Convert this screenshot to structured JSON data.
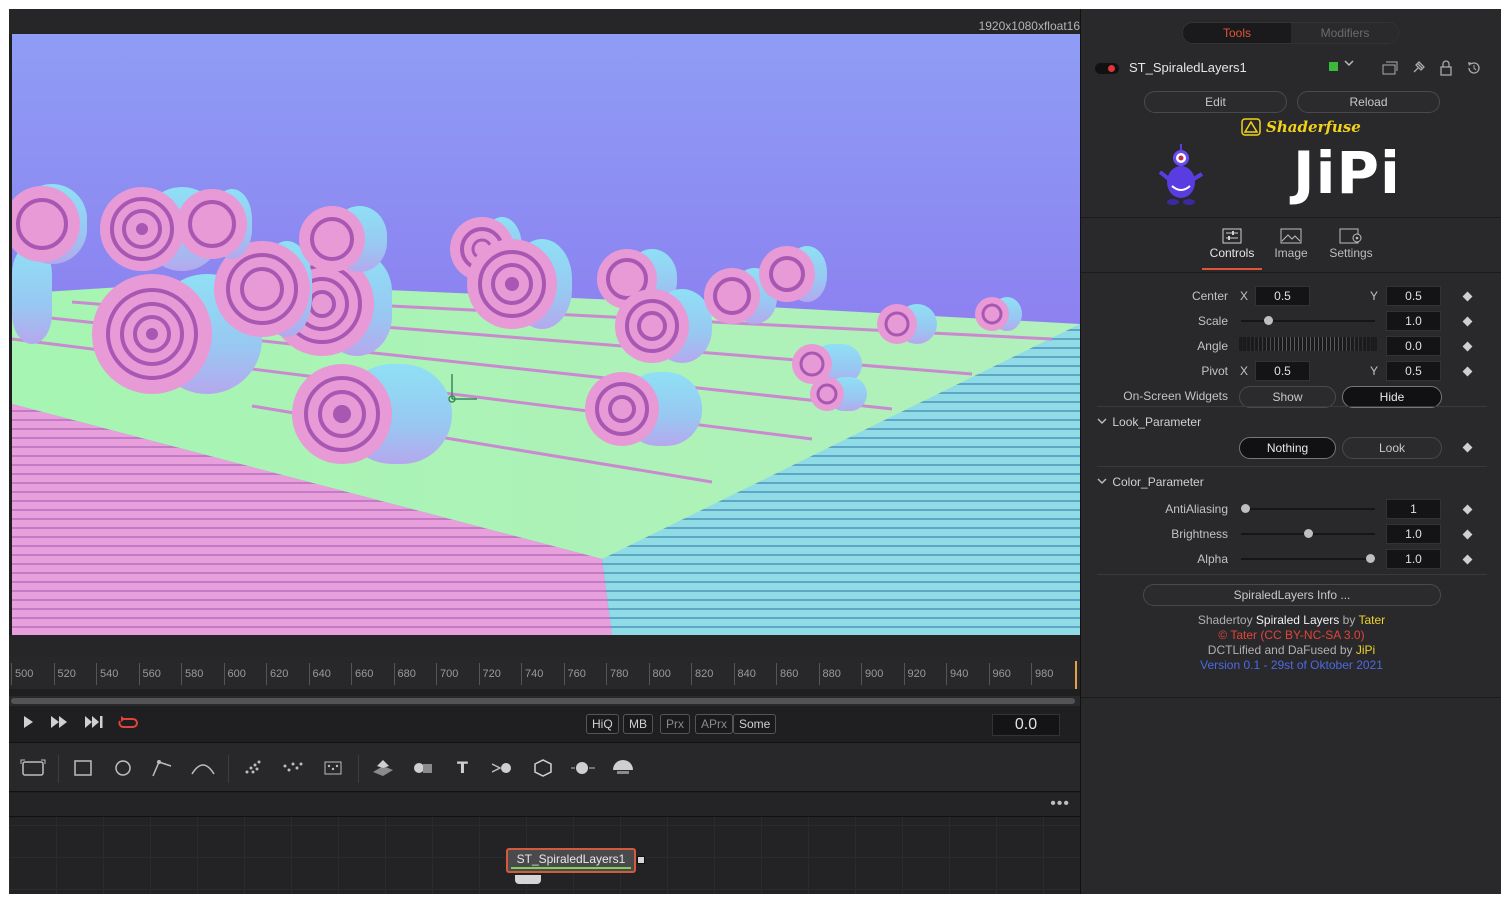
{
  "viewer": {
    "resolution": "1920x1080xfloat16"
  },
  "timeline": {
    "ticks": [
      "500",
      "520",
      "540",
      "560",
      "580",
      "600",
      "620",
      "640",
      "660",
      "680",
      "700",
      "720",
      "740",
      "760",
      "780",
      "800",
      "820",
      "840",
      "860",
      "880",
      "900",
      "920",
      "940",
      "960",
      "980"
    ],
    "current_time": "0.0"
  },
  "transport": {
    "quality_buttons": [
      {
        "label": "HiQ",
        "active": true
      },
      {
        "label": "MB",
        "active": true
      },
      {
        "label": "Prx",
        "active": false
      },
      {
        "label": "APrx",
        "active": false
      },
      {
        "label": "Some",
        "active": true
      }
    ]
  },
  "toolbar": {
    "icons": [
      "background-icon",
      "rectangle-mask-icon",
      "ellipse-mask-icon",
      "polygon-mask-icon",
      "bspline-mask-icon",
      "particle-emitter-icon",
      "particle-render-icon",
      "particle-image-icon",
      "shape3d-icon",
      "merge3d-icon",
      "text3d-icon",
      "renderer3d-icon",
      "imageplane3d-icon",
      "camera3d-icon",
      "light3d-icon"
    ]
  },
  "node_editor": {
    "node_label": "ST_SpiraledLayers1"
  },
  "inspector": {
    "tabs": {
      "tools": "Tools",
      "modifiers": "Modifiers"
    },
    "tool_name": "ST_SpiraledLayers1",
    "tool_color": "#3cb83c",
    "edit_label": "Edit",
    "reload_label": "Reload",
    "shaderfuse_label": "Shaderfuse",
    "logo_text": "JiPi",
    "sub_tabs": {
      "controls": "Controls",
      "image": "Image",
      "settings": "Settings"
    },
    "params": {
      "center": {
        "label": "Center",
        "x_axis": "X",
        "y_axis": "Y",
        "x": "0.5",
        "y": "0.5"
      },
      "scale": {
        "label": "Scale",
        "value": "1.0",
        "level": 0.18
      },
      "angle": {
        "label": "Angle",
        "value": "0.0"
      },
      "pivot": {
        "label": "Pivot",
        "x_axis": "X",
        "y_axis": "Y",
        "x": "0.5",
        "y": "0.5"
      },
      "widgets": {
        "label": "On-Screen Widgets",
        "show": "Show",
        "hide": "Hide"
      }
    },
    "look_section": {
      "title": "Look_Parameter",
      "nothing": "Nothing",
      "look": "Look"
    },
    "color_section": {
      "title": "Color_Parameter",
      "antialiasing": {
        "label": "AntiAliasing",
        "value": "1",
        "level": 0.0
      },
      "brightness": {
        "label": "Brightness",
        "value": "1.0",
        "level": 0.5
      },
      "alpha": {
        "label": "Alpha",
        "value": "1.0",
        "level": 1.0
      }
    },
    "info_button": "SpiraledLayers Info ...",
    "credits": {
      "line1_a": "Shadertoy ",
      "line1_b": "Spiraled Layers",
      "line1_c": " by ",
      "line1_d": "Tater",
      "line2": "© Tater (CC BY-NC-SA 3.0)",
      "line3_a": "DCTLified and DaFused by ",
      "line3_b": "JiPi",
      "line4": "Version 0.1 - 29st of Oktober 2021"
    }
  },
  "colors": {
    "accent": "#e2533a",
    "node_border": "#d35a3a",
    "shaderfuse_yellow": "#f2d31a",
    "version_blue": "#4c6ae0"
  }
}
